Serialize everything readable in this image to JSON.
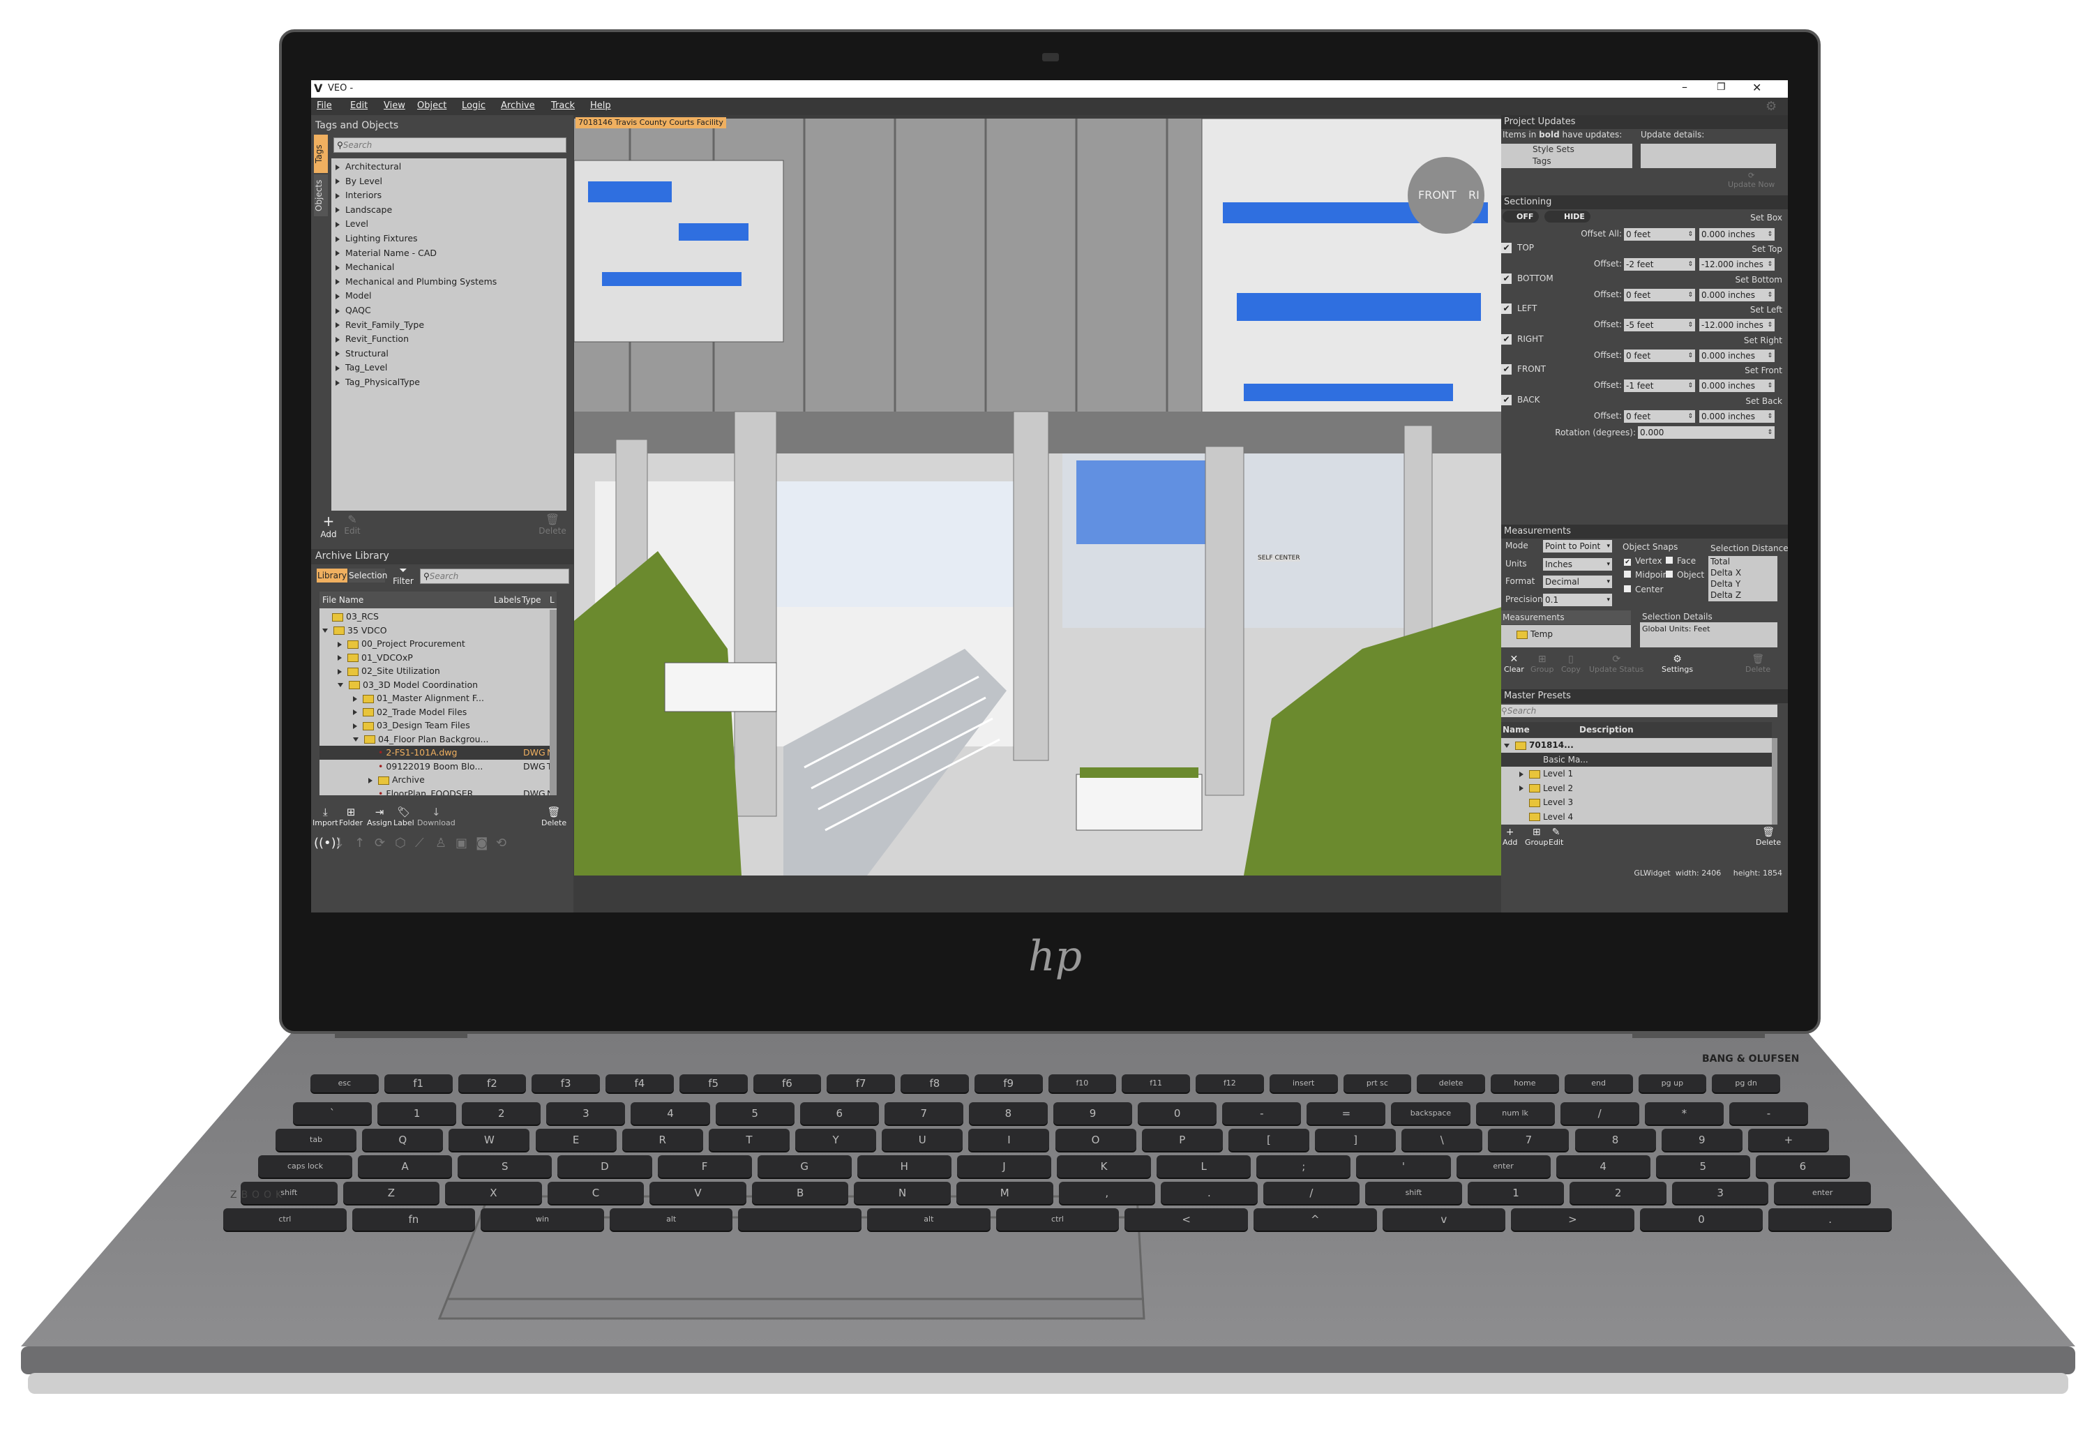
{
  "window": {
    "app_icon": "veo-logo-icon",
    "title": "VEO -",
    "controls": [
      "minimize-icon",
      "restore-icon",
      "close-icon"
    ]
  },
  "menu": [
    "File",
    "Edit",
    "View",
    "Object",
    "Logic",
    "Archive",
    "Track",
    "Help"
  ],
  "tags_panel": {
    "title": "Tags and Objects",
    "tabs": [
      "Tags",
      "Objects"
    ],
    "search_placeholder": "Search",
    "items": [
      "Architectural",
      "By Level",
      "Interiors",
      "Landscape",
      "Level",
      "Lighting Fixtures",
      "Material Name - CAD",
      "Mechanical",
      "Mechanical and Plumbing Systems",
      "Model",
      "QAQC",
      "Revit_Family_Type",
      "Revit_Function",
      "Structural",
      "Tag_Level",
      "Tag_PhysicalType"
    ],
    "toolbar": {
      "add": "Add",
      "edit": "Edit",
      "delete": "Delete"
    }
  },
  "archive": {
    "title": "Archive Library",
    "tabs": [
      "Library",
      "Selection"
    ],
    "filter": "Filter",
    "search_placeholder": "Search",
    "columns": [
      "File Name",
      "Labels",
      "Type",
      "L"
    ],
    "rows": [
      {
        "name": "03_RCS",
        "kind": "folder",
        "depth": 0,
        "toggle": "none",
        "type": "",
        "last": ""
      },
      {
        "name": "35 VDCO",
        "kind": "folder",
        "depth": 0,
        "toggle": "open",
        "type": "",
        "last": ""
      },
      {
        "name": "00_Project Procurement",
        "kind": "folder",
        "depth": 1,
        "toggle": "closed",
        "type": "",
        "last": ""
      },
      {
        "name": "01_VDCOxP",
        "kind": "folder",
        "depth": 1,
        "toggle": "closed",
        "type": "",
        "last": ""
      },
      {
        "name": "02_Site Utilization",
        "kind": "folder",
        "depth": 1,
        "toggle": "closed",
        "type": "",
        "last": ""
      },
      {
        "name": "03_3D Model Coordination",
        "kind": "folder",
        "depth": 1,
        "toggle": "open",
        "type": "",
        "last": ""
      },
      {
        "name": "01_Master Alignment F...",
        "kind": "folder",
        "depth": 2,
        "toggle": "closed",
        "type": "",
        "last": ""
      },
      {
        "name": "02_Trade Model Files",
        "kind": "folder",
        "depth": 2,
        "toggle": "closed",
        "type": "",
        "last": ""
      },
      {
        "name": "03_Design Team Files",
        "kind": "folder",
        "depth": 2,
        "toggle": "closed",
        "type": "",
        "last": ""
      },
      {
        "name": "04_Floor Plan Backgrou...",
        "kind": "folder",
        "depth": 2,
        "toggle": "open",
        "type": "",
        "last": ""
      },
      {
        "name": "2-FS1-101A.dwg",
        "kind": "file",
        "depth": 3,
        "toggle": "none",
        "type": "DWG",
        "last": "N",
        "selected": true
      },
      {
        "name": "09122019 Boom Blo...",
        "kind": "file",
        "depth": 3,
        "toggle": "none",
        "type": "DWG",
        "last": "T"
      },
      {
        "name": "Archive",
        "kind": "folder",
        "depth": 3,
        "toggle": "closed",
        "type": "",
        "last": ""
      },
      {
        "name": "FloorPlan_FOODSER...",
        "kind": "file",
        "depth": 3,
        "toggle": "none",
        "type": "DWG",
        "last": "N"
      }
    ],
    "toolbar": [
      "Import",
      "Folder",
      "Assign",
      "Label",
      "Download",
      "Delete"
    ],
    "status_icons": [
      "broadcast-icon",
      "arrow-down-icon",
      "arrow-up-icon",
      "sync-icon",
      "cube-icon",
      "ruler-icon",
      "person-icon",
      "box-icon",
      "camera-icon",
      "camera-rotate-icon"
    ]
  },
  "viewport": {
    "tab": "7018146 Travis County Courts Facility",
    "view_cube_labels": [
      "FRONT",
      "RI"
    ],
    "sign": "SELF CENTER"
  },
  "updates": {
    "title": "Project Updates",
    "items_label_pre": "Items in ",
    "items_label_bold": "bold",
    "items_label_post": " have updates:",
    "details_label": "Update details:",
    "items": [
      "Style Sets",
      "Tags"
    ],
    "update_now": "Update Now"
  },
  "sectioning": {
    "title": "Sectioning",
    "off": "OFF",
    "hide": "HIDE",
    "set_box": "Set Box",
    "offset_all_label": "Offset All:",
    "offset_all_feet": "0 feet",
    "offset_all_inches": "0.000 inches",
    "offset_label": "Offset:",
    "sides": [
      {
        "label": "TOP",
        "set": "Set Top",
        "feet": "-2 feet",
        "inches": "-12.000 inches",
        "checked": true
      },
      {
        "label": "BOTTOM",
        "set": "Set Bottom",
        "feet": "0 feet",
        "inches": "0.000 inches",
        "checked": true
      },
      {
        "label": "LEFT",
        "set": "Set Left",
        "feet": "-5 feet",
        "inches": "-12.000 inches",
        "checked": true
      },
      {
        "label": "RIGHT",
        "set": "Set Right",
        "feet": "0 feet",
        "inches": "0.000 inches",
        "checked": true
      },
      {
        "label": "FRONT",
        "set": "Set Front",
        "feet": "-1 feet",
        "inches": "0.000 inches",
        "checked": true
      },
      {
        "label": "BACK",
        "set": "Set Back",
        "feet": "0 feet",
        "inches": "0.000 inches",
        "checked": true
      }
    ],
    "rotation_label": "Rotation (degrees):",
    "rotation": "0.000"
  },
  "measurements": {
    "title": "Measurements",
    "mode_label": "Mode",
    "mode": "Point to Point",
    "units_label": "Units",
    "units": "Inches",
    "format_label": "Format",
    "format": "Decimal",
    "precision_label": "Precision",
    "precision": "0.1",
    "snaps_title": "Object Snaps",
    "snaps": [
      {
        "label": "Vertex",
        "checked": true
      },
      {
        "label": "Face",
        "checked": false
      },
      {
        "label": "Midpoint",
        "checked": false
      },
      {
        "label": "Object",
        "checked": false
      },
      {
        "label": "Center",
        "checked": false
      }
    ],
    "distance_title": "Selection Distance",
    "distance_rows": [
      "Total",
      "Delta X",
      "Delta Y",
      "Delta Z"
    ],
    "list_title": "Measurements",
    "list_items": [
      "Temp"
    ],
    "details_title": "Selection Details",
    "details_text": "Global Units: Feet",
    "toolbar": [
      {
        "label": "Clear",
        "enabled": true
      },
      {
        "label": "Group",
        "enabled": false
      },
      {
        "label": "Copy",
        "enabled": false
      },
      {
        "label": "Update Status",
        "enabled": false
      },
      {
        "label": "Settings",
        "enabled": true
      },
      {
        "label": "Delete",
        "enabled": false
      }
    ]
  },
  "presets": {
    "title": "Master Presets",
    "search_placeholder": "Search",
    "columns": [
      "Name",
      "Description"
    ],
    "rows": [
      {
        "name": "701814...",
        "depth": 0,
        "toggle": "open",
        "folder": true,
        "bold": true
      },
      {
        "name": "Basic Ma...",
        "depth": 1,
        "toggle": "none",
        "folder": false,
        "selected": true
      },
      {
        "name": "Level 1",
        "depth": 1,
        "toggle": "closed",
        "folder": true
      },
      {
        "name": "Level 2",
        "depth": 1,
        "toggle": "closed",
        "folder": true
      },
      {
        "name": "Level 3",
        "depth": 1,
        "toggle": "none",
        "folder": true
      },
      {
        "name": "Level 4",
        "depth": 1,
        "toggle": "none",
        "folder": true
      }
    ],
    "toolbar": [
      "Add",
      "Group",
      "Edit",
      "Delete"
    ]
  },
  "status": {
    "text": "GLWidget  width: 2406     height: 1854"
  },
  "device": {
    "logo": "hp",
    "brand_strip": "BANG & OLUFSEN",
    "side_label": "ZBOOK"
  },
  "keyboard": {
    "rows": [
      [
        "esc",
        "f1",
        "f2",
        "f3",
        "f4",
        "f5",
        "f6",
        "f7",
        "f8",
        "f9",
        "f10",
        "f11",
        "f12",
        "insert",
        "prt sc",
        "delete",
        "home",
        "end",
        "pg up",
        "pg dn"
      ],
      [
        "`",
        "1",
        "2",
        "3",
        "4",
        "5",
        "6",
        "7",
        "8",
        "9",
        "0",
        "-",
        "=",
        "backspace",
        "num lk",
        "/",
        "*",
        "-"
      ],
      [
        "tab",
        "Q",
        "W",
        "E",
        "R",
        "T",
        "Y",
        "U",
        "I",
        "O",
        "P",
        "[",
        "]",
        "\\",
        "7",
        "8",
        "9",
        "+"
      ],
      [
        "caps lock",
        "A",
        "S",
        "D",
        "F",
        "G",
        "H",
        "J",
        "K",
        "L",
        ";",
        "'",
        "enter",
        "4",
        "5",
        "6"
      ],
      [
        "shift",
        "Z",
        "X",
        "C",
        "V",
        "B",
        "N",
        "M",
        ",",
        ".",
        "/",
        "shift",
        "1",
        "2",
        "3",
        "enter"
      ],
      [
        "ctrl",
        "fn",
        "win",
        "alt",
        "",
        "alt",
        "ctrl",
        "<",
        "^",
        "v",
        ">",
        "0",
        "."
      ]
    ]
  },
  "colors": {
    "accent": "#f0b060",
    "panel": "#454545",
    "list": "#c9c9c9",
    "folder": "#e8c43a",
    "hedge": "#6b8a2e",
    "pipe": "#2f6fe0"
  }
}
